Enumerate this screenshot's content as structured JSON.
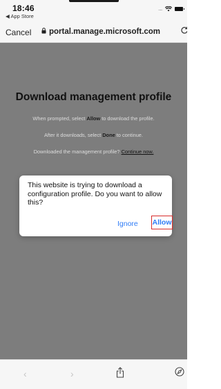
{
  "status_bar": {
    "time": "18:46",
    "back_app": "◀ App Store",
    "signal": "....."
  },
  "browser": {
    "cancel_label": "Cancel",
    "url": "portal.manage.microsoft.com"
  },
  "page": {
    "title": "Download management profile",
    "line1_pre": "When prompted, select ",
    "line1_bold": "Allow",
    "line1_post": " to download the profile.",
    "line2_pre": "After it downloads, select ",
    "line2_bold": "Done",
    "line2_post": " to continue.",
    "line3_pre": "Downloaded the management profile? ",
    "line3_link": "Continue now."
  },
  "dialog": {
    "message": "This website is trying to download a configuration profile. Do you want to allow this?",
    "ignore_label": "Ignore",
    "allow_label": "Allow",
    "highlight_color": "#d72a2a"
  },
  "toolbar": {
    "back_icon": "‹",
    "forward_icon": "›"
  }
}
